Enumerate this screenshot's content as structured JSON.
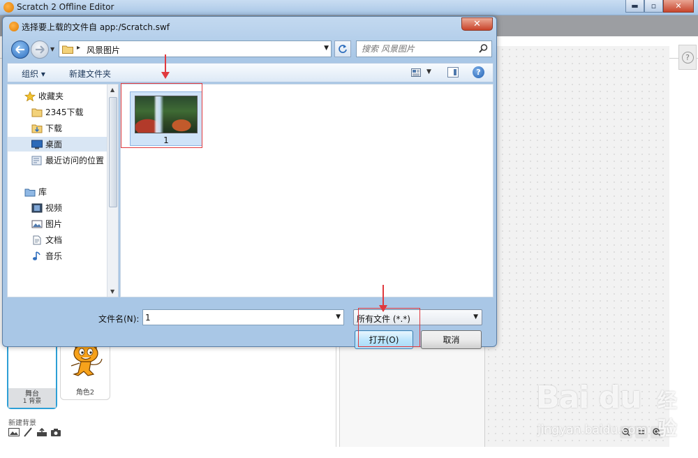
{
  "main_window": {
    "title": "Scratch 2 Offline Editor",
    "controls": {
      "minimize": "▬",
      "maximize": "▫",
      "close": "✕"
    }
  },
  "dialog": {
    "title": "选择要上载的文件自 app:/Scratch.swf",
    "close_glyph": "✕",
    "address": {
      "arrow": "▸",
      "crumb": "风景图片"
    },
    "search_placeholder": "搜索 风景图片",
    "toolbar": {
      "organize": "组织 ▾",
      "new_folder": "新建文件夹",
      "help": "?"
    },
    "nav_items": [
      {
        "label": "收藏夹",
        "icon": "star-icon"
      },
      {
        "label": "2345下载",
        "icon": "folder-icon"
      },
      {
        "label": "下载",
        "icon": "download-folder-icon"
      },
      {
        "label": "桌面",
        "icon": "desktop-icon",
        "selected": true
      },
      {
        "label": "最近访问的位置",
        "icon": "recent-places-icon"
      },
      {
        "label": "库",
        "icon": "library-icon"
      },
      {
        "label": "视频",
        "icon": "video-icon"
      },
      {
        "label": "图片",
        "icon": "pictures-icon"
      },
      {
        "label": "文档",
        "icon": "documents-icon"
      },
      {
        "label": "音乐",
        "icon": "music-icon"
      }
    ],
    "files": [
      {
        "name": "1"
      }
    ],
    "filename_label": "文件名(N):",
    "filename_value": "1",
    "filetype_value": "所有文件 (*.*)",
    "open_button": "打开(O)",
    "cancel_button": "取消"
  },
  "scratch": {
    "stage_label": "舞台",
    "stage_sublabel": "1 背景",
    "sprite_name": "角色2",
    "new_backdrop_label": "新建背景",
    "help_glyph": "?"
  },
  "watermark": {
    "brand": "Bai du",
    "jingyan": "经验",
    "url": "jingyan.baidu.com"
  },
  "colors": {
    "highlight_red": "#e0393e",
    "selection_blue": "#cfe3f8",
    "open_button_blue": "#bee6fd"
  }
}
